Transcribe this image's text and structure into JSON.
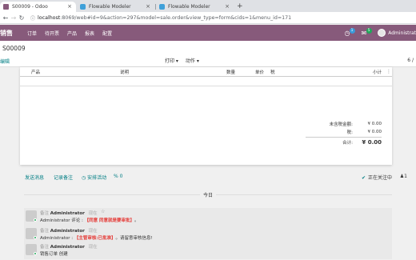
{
  "browser": {
    "tabs": [
      {
        "title": "S00009 - Odoo",
        "active": true,
        "favicon": "odoo-icon"
      },
      {
        "title": "Flowable Modeler",
        "active": false,
        "favicon": "flowable-icon"
      },
      {
        "title": "Flowable Modeler",
        "active": false,
        "favicon": "flowable-icon"
      }
    ],
    "close_glyph": "×",
    "new_tab_glyph": "+",
    "url_host": "localhost",
    "url_rest": ":8069/web#id=9&action=297&model=sale.order&view_type=form&cids=1&menu_id=171"
  },
  "topnav": {
    "app_name": "销售",
    "menu": [
      "订单",
      "待开票",
      "产品",
      "报表",
      "配置"
    ],
    "activity_badge": "1",
    "chat_badge": "5",
    "username": "Administrat"
  },
  "control_panel": {
    "breadcrumb": "S00009",
    "edit_label": "编辑",
    "print_label": "打印 ▾",
    "action_label": "动作 ▾",
    "pager": "6 /"
  },
  "order_lines": {
    "columns": [
      "产品",
      "说明",
      "数量",
      "单价",
      "税",
      "小计"
    ]
  },
  "totals": {
    "untaxed_label": "未含税金额:",
    "untaxed_value": "¥ 0.00",
    "tax_label": "税:",
    "tax_value": "¥ 0.00",
    "total_label": "合计:",
    "total_value": "¥ 0.00"
  },
  "chatter": {
    "send_message": "发送消息",
    "log_note": "记录备注",
    "schedule": "◷ 安排活动",
    "attachments": "0",
    "following": "正在关注中",
    "followers_count": "1",
    "day_separator": "今日",
    "messages": [
      {
        "type": "备注",
        "author": "Administrator",
        "when": "现在",
        "prefix": "Administrator 评论 : ",
        "tag": "【同意 同意就是要审批】",
        "suffix": "。"
      },
      {
        "type": "备注",
        "author": "Administrator",
        "when": "现在",
        "prefix": "Administrator : ",
        "tag": "【主管审核:已批准】",
        "suffix": "。请留意审核信息!"
      },
      {
        "type": "备注",
        "author": "Administrator",
        "when": "现在",
        "prefix": "销售订单 创建",
        "tag": "",
        "suffix": ""
      }
    ]
  },
  "colors": {
    "brand": "#875a7b",
    "accent": "#017e84",
    "highlight": "#e53935"
  }
}
